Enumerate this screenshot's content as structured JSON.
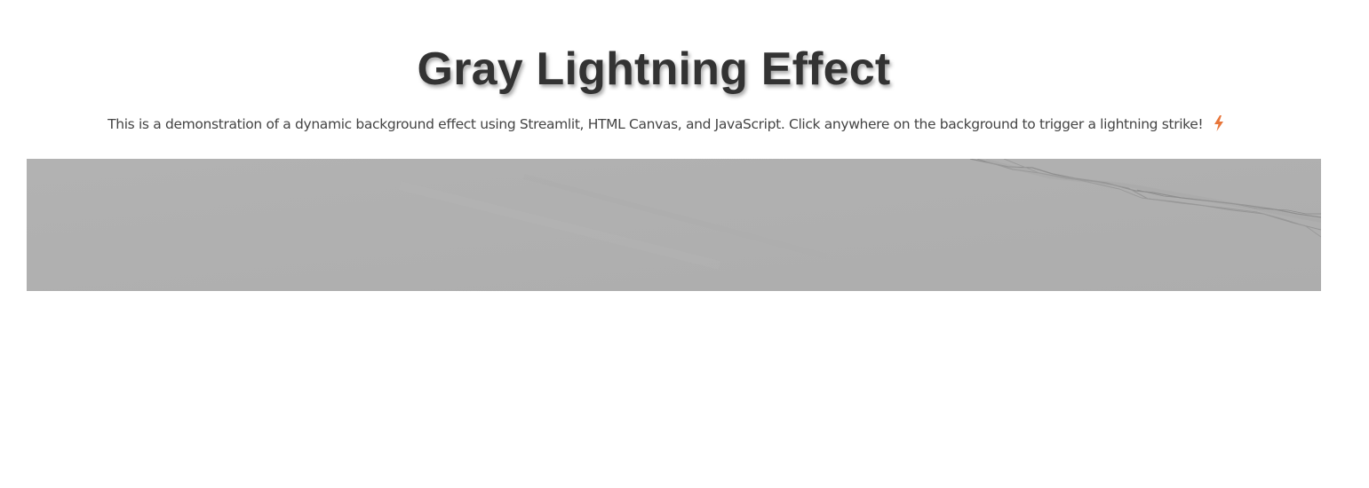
{
  "page": {
    "title": "Gray Lightning Effect",
    "description": "This is a demonstration of a dynamic background effect using Streamlit, HTML Canvas, and JavaScript. Click anywhere on the background to trigger a lightning strike!",
    "description_icon": "lightning-bolt-icon"
  },
  "canvas": {
    "background_color": "#b0b0b0",
    "bolt_color": "#8a8a8a",
    "accent_color": "#e8763a"
  }
}
